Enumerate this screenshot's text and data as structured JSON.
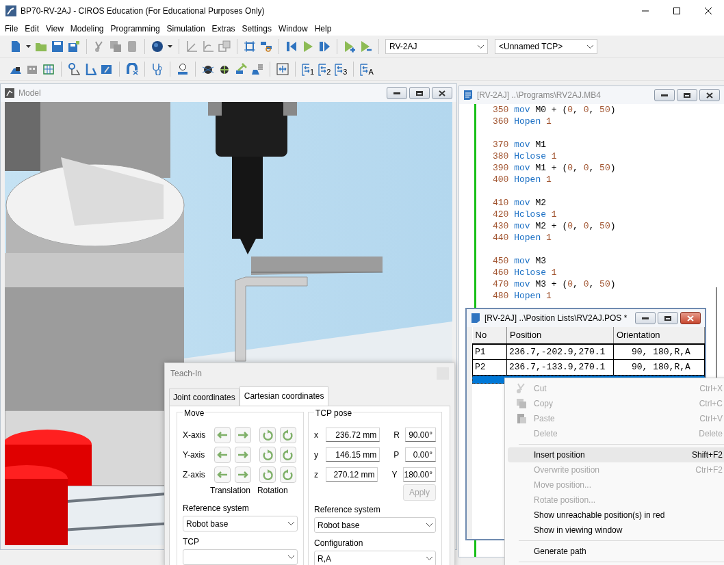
{
  "window": {
    "title": "BP70-RV-2AJ - CIROS Education (For Educational Purposes Only)"
  },
  "menu": [
    "File",
    "Edit",
    "View",
    "Modeling",
    "Programming",
    "Simulation",
    "Extras",
    "Settings",
    "Window",
    "Help"
  ],
  "toolbar": {
    "robot": "RV-2AJ",
    "tcp": "<Unnamed TCP>",
    "step_labels": [
      "1",
      "2",
      "3",
      "A"
    ]
  },
  "model_window": {
    "title": "Model"
  },
  "program_window": {
    "title": "[RV-2AJ] ..\\Programs\\RV2AJ.MB4",
    "lines": [
      {
        "kind": "code",
        "number": "350",
        "command": "mov",
        "args": "M0 + (0, 0, 50)"
      },
      {
        "kind": "code",
        "number": "360",
        "command": "Hopen",
        "args": "1"
      },
      {
        "kind": "blank"
      },
      {
        "kind": "code",
        "number": "370",
        "command": "mov",
        "args": "M1"
      },
      {
        "kind": "code",
        "number": "380",
        "command": "Hclose",
        "args": "1"
      },
      {
        "kind": "code",
        "number": "390",
        "command": "mov",
        "args": "M1 + (0, 0, 50)"
      },
      {
        "kind": "code",
        "number": "400",
        "command": "Hopen",
        "args": "1"
      },
      {
        "kind": "blank"
      },
      {
        "kind": "code",
        "number": "410",
        "command": "mov",
        "args": "M2"
      },
      {
        "kind": "code",
        "number": "420",
        "command": "Hclose",
        "args": "1"
      },
      {
        "kind": "code",
        "number": "430",
        "command": "mov",
        "args": "M2 + (0, 0, 50)"
      },
      {
        "kind": "code",
        "number": "440",
        "command": "Hopen",
        "args": "1"
      },
      {
        "kind": "blank"
      },
      {
        "kind": "code",
        "number": "450",
        "command": "mov",
        "args": "M3"
      },
      {
        "kind": "code",
        "number": "460",
        "command": "Hclose",
        "args": "1"
      },
      {
        "kind": "code",
        "number": "470",
        "command": "mov",
        "args": "M3 + (0, 0, 50)"
      },
      {
        "kind": "code",
        "number": "480",
        "command": "Hopen",
        "args": "1"
      }
    ]
  },
  "position_window": {
    "title": "[RV-2AJ] ..\\Position Lists\\RV2AJ.POS *",
    "columns": [
      "No",
      "Position",
      "Orientation"
    ],
    "rows": [
      {
        "no": "P1",
        "position": "236.7,-202.9,270.1",
        "orientation": "90, 180,R,A",
        "selected": false
      },
      {
        "no": "P2",
        "position": "236.7,-133.9,270.1",
        "orientation": "90, 180,R,A",
        "selected": false
      }
    ],
    "new_row": {
      "selected": true
    }
  },
  "teach_in": {
    "title": "Teach-In",
    "tabs": [
      {
        "label": "Joint coordinates",
        "selected": false
      },
      {
        "label": "Cartesian coordinates",
        "selected": true
      }
    ],
    "move": {
      "title": "Move",
      "axes": [
        "X-axis",
        "Y-axis",
        "Z-axis"
      ],
      "translation_label": "Translation",
      "rotation_label": "Rotation",
      "reference_label": "Reference system",
      "reference": "Robot base",
      "tcp_label": "TCP"
    },
    "pose": {
      "title": "TCP pose",
      "position": [
        {
          "axis": "x",
          "value": "236.72 mm"
        },
        {
          "axis": "y",
          "value": "146.15 mm"
        },
        {
          "axis": "z",
          "value": "270.12 mm"
        }
      ],
      "orientation": [
        {
          "axis": "R",
          "value": "90.00°"
        },
        {
          "axis": "P",
          "value": "0.00°"
        },
        {
          "axis": "Y",
          "value": "180.00°"
        }
      ],
      "apply": {
        "label": "Apply",
        "disabled": true
      },
      "reference_label": "Reference system",
      "reference": "Robot base",
      "configuration_label": "Configuration",
      "configuration": "R,A"
    }
  },
  "context_menu": {
    "items": [
      {
        "kind": "item",
        "label": "Cut",
        "shortcut": "Ctrl+X",
        "disabled": true,
        "selected": false
      },
      {
        "kind": "item",
        "label": "Copy",
        "shortcut": "Ctrl+C",
        "disabled": true,
        "selected": false
      },
      {
        "kind": "item",
        "label": "Paste",
        "shortcut": "Ctrl+V",
        "disabled": true,
        "selected": false
      },
      {
        "kind": "item",
        "label": "Delete",
        "shortcut": "Delete",
        "disabled": true,
        "selected": false
      },
      {
        "kind": "separator"
      },
      {
        "kind": "item",
        "label": "Insert position",
        "shortcut": "Shift+F2",
        "disabled": false,
        "selected": true
      },
      {
        "kind": "item",
        "label": "Overwrite position",
        "shortcut": "Ctrl+F2",
        "disabled": true,
        "selected": false
      },
      {
        "kind": "item",
        "label": "Move position...",
        "disabled": true,
        "selected": false
      },
      {
        "kind": "item",
        "label": "Rotate position...",
        "disabled": true,
        "selected": false
      },
      {
        "kind": "item",
        "label": "Show unreachable position(s) in red",
        "disabled": false,
        "selected": false
      },
      {
        "kind": "item",
        "label": "Show in viewing window",
        "disabled": false,
        "selected": false
      },
      {
        "kind": "separator"
      },
      {
        "kind": "item",
        "label": "Generate path",
        "disabled": false,
        "selected": false
      },
      {
        "kind": "separator"
      }
    ]
  }
}
